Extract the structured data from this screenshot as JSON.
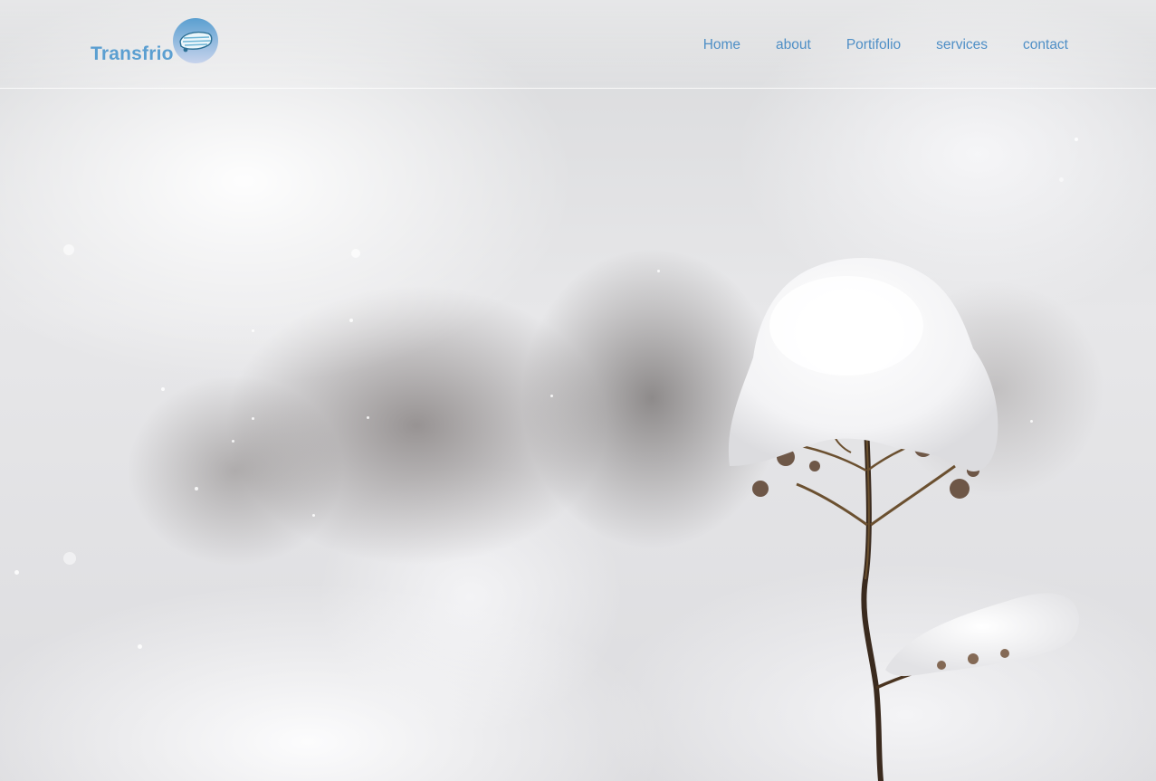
{
  "brand": {
    "name": "Transfrio",
    "logo_icon": "transfrio-logo-badge-icon",
    "color": "#5b9fd1"
  },
  "nav": {
    "items": [
      {
        "label": "Home"
      },
      {
        "label": "about"
      },
      {
        "label": "Portifolio"
      },
      {
        "label": "services"
      },
      {
        "label": "contact"
      }
    ],
    "color": "#4f8fc6"
  },
  "hero": {
    "image": "snow-covered-plant-photo"
  }
}
